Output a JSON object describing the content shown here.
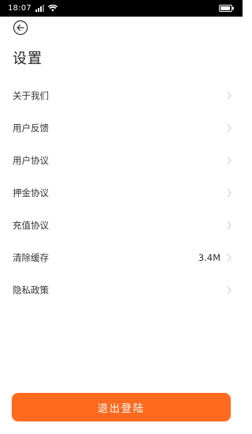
{
  "status_bar": {
    "time": "18:07",
    "signal_icon": "signal-icon",
    "wifi_icon": "wifi-icon",
    "battery_icon": "battery-icon"
  },
  "header": {
    "back_icon": "back-arrow-icon",
    "title": "设置"
  },
  "menu": {
    "items": [
      {
        "label": "关于我们",
        "value": ""
      },
      {
        "label": "用户反馈",
        "value": ""
      },
      {
        "label": "用户协议",
        "value": ""
      },
      {
        "label": "押金协议",
        "value": ""
      },
      {
        "label": "充值协议",
        "value": ""
      },
      {
        "label": "清除缓存",
        "value": "3.4M"
      },
      {
        "label": "隐私政策",
        "value": ""
      }
    ],
    "chevron_icon": "chevron-right-icon"
  },
  "footer": {
    "logout_label": "退出登陆"
  },
  "colors": {
    "accent": "#ff6a1f",
    "text": "#333333",
    "chevron": "#c8c8c8"
  }
}
